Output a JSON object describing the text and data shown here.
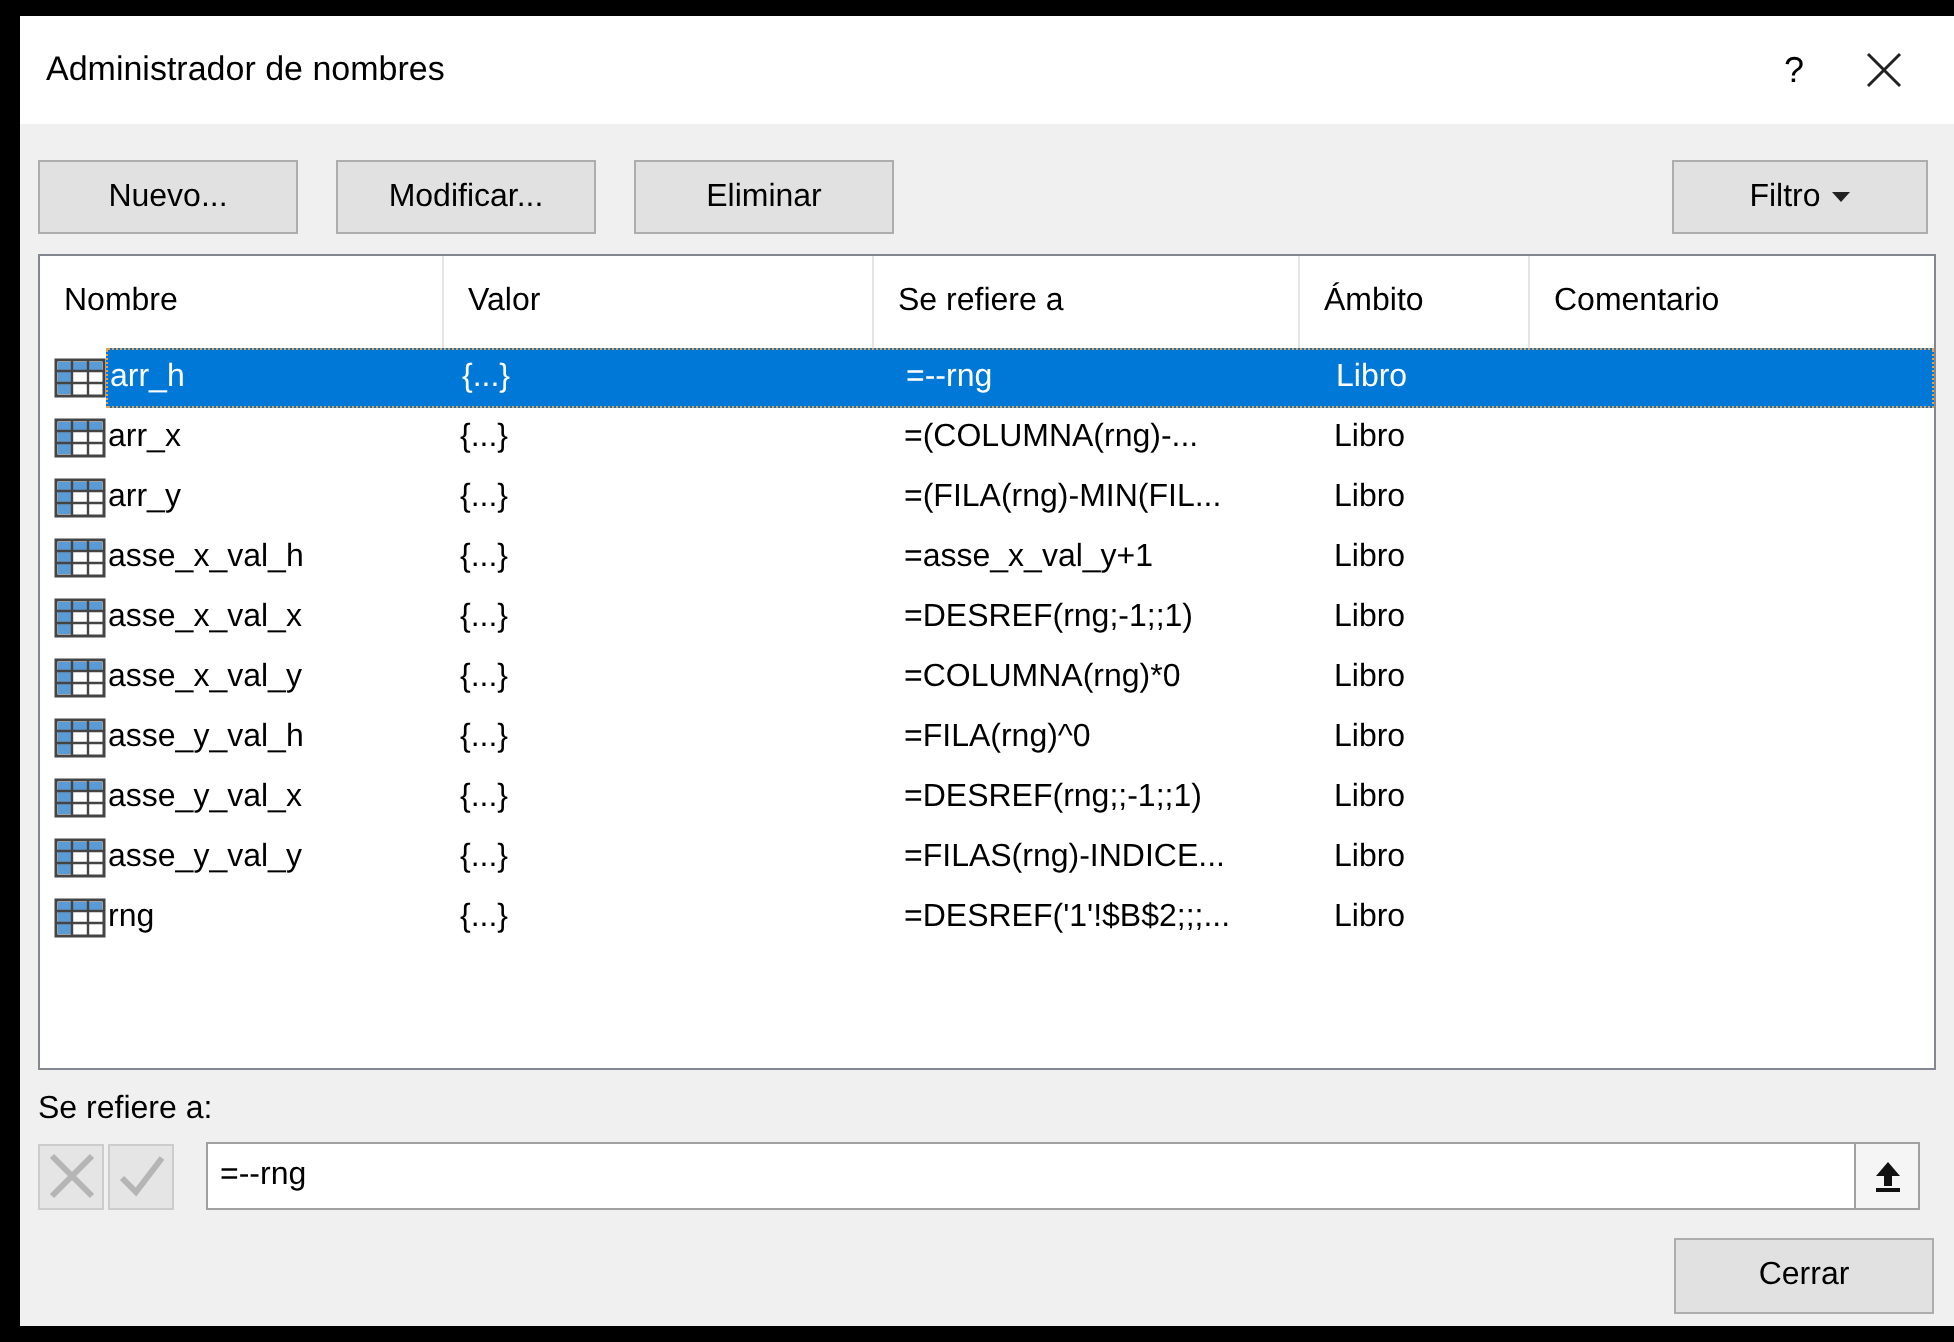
{
  "window": {
    "title": "Administrador de nombres",
    "help": "?"
  },
  "toolbar": {
    "buttons": [
      "Nuevo...",
      "Modificar...",
      "Eliminar"
    ],
    "filter": "Filtro"
  },
  "table": {
    "columns": [
      "Nombre",
      "Valor",
      "Se refiere a",
      "Ámbito",
      "Comentario"
    ],
    "rows": [
      {
        "name": "arr_h",
        "value": "{...}",
        "refers_to": "=--rng",
        "scope": "Libro",
        "selected": true
      },
      {
        "name": "arr_x",
        "value": "{...}",
        "refers_to": "=(COLUMNA(rng)-...",
        "scope": "Libro",
        "selected": false
      },
      {
        "name": "arr_y",
        "value": "{...}",
        "refers_to": "=(FILA(rng)-MIN(FIL...",
        "scope": "Libro",
        "selected": false
      },
      {
        "name": "asse_x_val_h",
        "value": "{...}",
        "refers_to": "=asse_x_val_y+1",
        "scope": "Libro",
        "selected": false
      },
      {
        "name": "asse_x_val_x",
        "value": "{...}",
        "refers_to": "=DESREF(rng;-1;;1)",
        "scope": "Libro",
        "selected": false
      },
      {
        "name": "asse_x_val_y",
        "value": "{...}",
        "refers_to": "=COLUMNA(rng)*0",
        "scope": "Libro",
        "selected": false
      },
      {
        "name": "asse_y_val_h",
        "value": "{...}",
        "refers_to": "=FILA(rng)^0",
        "scope": "Libro",
        "selected": false
      },
      {
        "name": "asse_y_val_x",
        "value": "{...}",
        "refers_to": "=DESREF(rng;;-1;;1)",
        "scope": "Libro",
        "selected": false
      },
      {
        "name": "asse_y_val_y",
        "value": "{...}",
        "refers_to": "=FILAS(rng)-INDICE...",
        "scope": "Libro",
        "selected": false
      },
      {
        "name": "rng",
        "value": "{...}",
        "refers_to": "=DESREF('1'!$B$2;;;...",
        "scope": "Libro",
        "selected": false
      }
    ]
  },
  "refers_to": {
    "label": "Se refiere a:",
    "value": "=--rng",
    "cancel_disabled": true,
    "confirm_disabled": true
  },
  "buttons": [
    "Cerrar"
  ]
}
